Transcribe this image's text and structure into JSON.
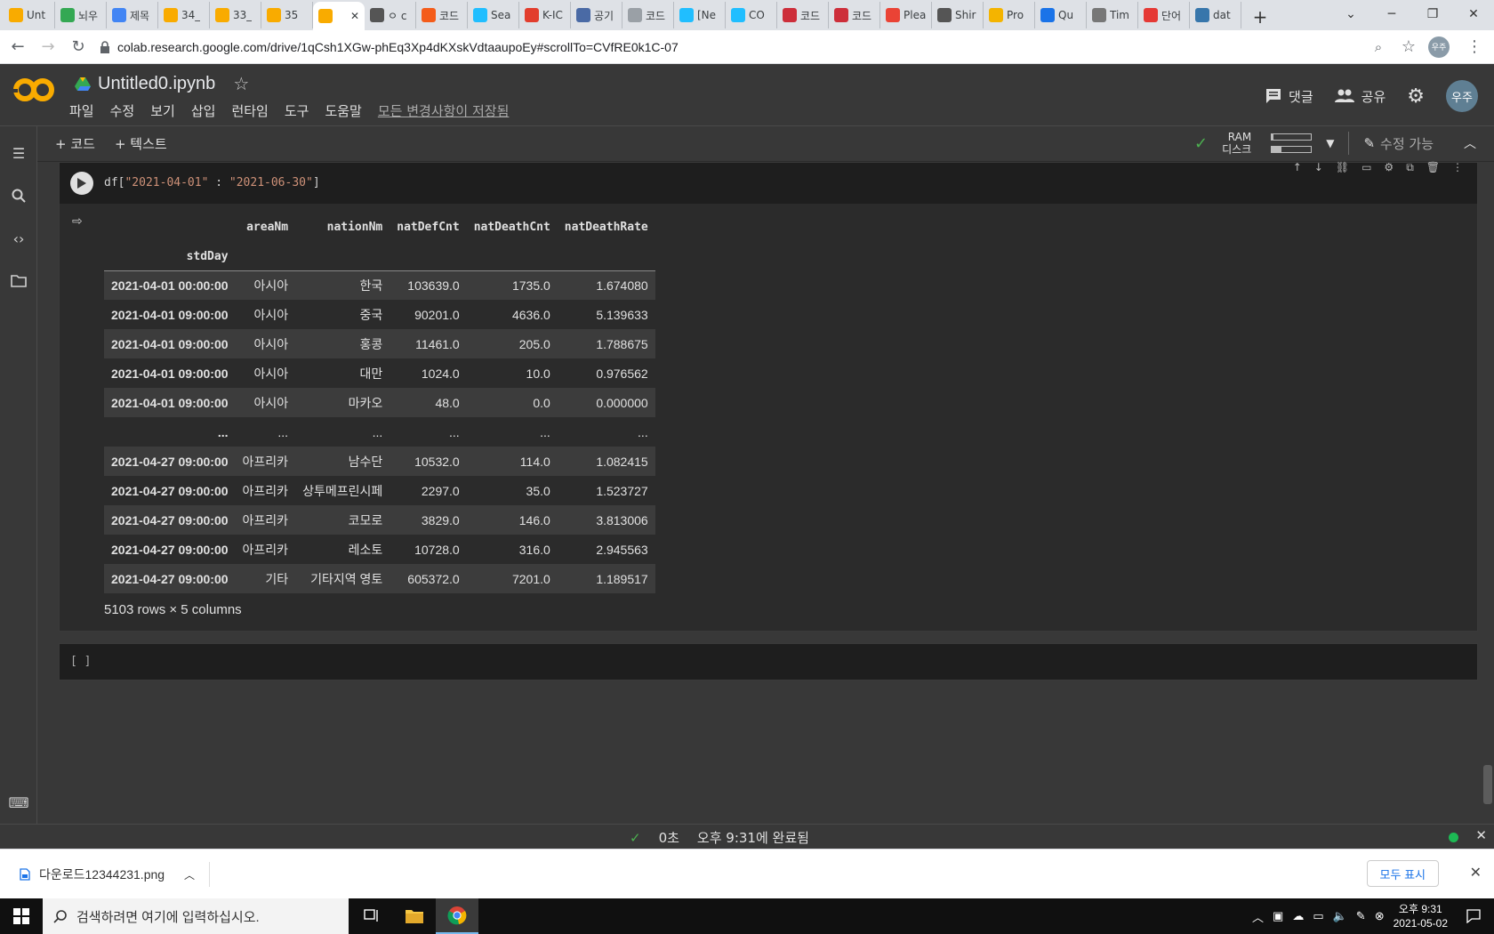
{
  "browser": {
    "tabs": [
      {
        "title": "Unt",
        "icon": "colab-icon",
        "color": "#f9ab00"
      },
      {
        "title": "뇌우",
        "icon": "drive-icon",
        "color": "#34a853"
      },
      {
        "title": "제목",
        "icon": "docs-icon",
        "color": "#4285f4"
      },
      {
        "title": "34_",
        "icon": "colab-icon",
        "color": "#f9ab00"
      },
      {
        "title": "33_",
        "icon": "colab-icon",
        "color": "#f9ab00"
      },
      {
        "title": "35",
        "icon": "colab-icon",
        "color": "#f9ab00"
      },
      {
        "title": "",
        "icon": "colab-icon",
        "color": "#f9ab00",
        "active": true
      },
      {
        "title": "ㅇ c",
        "icon": "dots-icon",
        "color": "#555"
      },
      {
        "title": "코드",
        "icon": "k-icon",
        "color": "#f45c1a"
      },
      {
        "title": "Sea",
        "icon": "k-icon",
        "color": "#20beff"
      },
      {
        "title": "K-IC",
        "icon": "k-icon",
        "color": "#e23d2d"
      },
      {
        "title": "공기",
        "icon": "globe-icon",
        "color": "#4a6aa5"
      },
      {
        "title": "코드",
        "icon": "globe-icon",
        "color": "#9aa0a6"
      },
      {
        "title": "[Ne",
        "icon": "k-icon",
        "color": "#20beff"
      },
      {
        "title": "CO",
        "icon": "k-icon",
        "color": "#20beff"
      },
      {
        "title": "코드",
        "icon": "flag-icon",
        "color": "#cd2e3a"
      },
      {
        "title": "코드",
        "icon": "flag-icon",
        "color": "#cd2e3a"
      },
      {
        "title": "Plea",
        "icon": "gmail-icon",
        "color": "#ea4335"
      },
      {
        "title": "Shir",
        "icon": "dots-icon",
        "color": "#555"
      },
      {
        "title": "Pro",
        "icon": "box-icon",
        "color": "#f4b400"
      },
      {
        "title": "Qu",
        "icon": "q-icon",
        "color": "#1a73e8"
      },
      {
        "title": "Tim",
        "icon": "image-icon",
        "color": "#777"
      },
      {
        "title": "단어",
        "icon": "z-icon",
        "color": "#e53935"
      },
      {
        "title": "dat",
        "icon": "python-icon",
        "color": "#3776ab"
      }
    ],
    "new_tab": "+",
    "url": "colab.research.google.com/drive/1qCsh1XGw-phEq3Xp4dKXskVdtaaupoEy#scrollTo=CVfRE0k1C-07",
    "profile": "우주"
  },
  "colab": {
    "notebook_title": "Untitled0.ipynb",
    "menu": [
      "파일",
      "수정",
      "보기",
      "삽입",
      "런타임",
      "도구",
      "도움말"
    ],
    "saved_status": "모든 변경사항이 저장됨",
    "comment_label": "댓글",
    "share_label": "공유",
    "avatar": "우주",
    "add_code": "+ 코드",
    "add_text": "+ 텍스트",
    "ram_label": "RAM",
    "disk_label": "디스크",
    "ram_usage": 0.05,
    "disk_usage": 0.25,
    "edit_mode": "수정 가능"
  },
  "cell": {
    "code_prefix": "df[",
    "code_str1": "\"2021-04-01\"",
    "code_sep": " : ",
    "code_str2": "\"2021-06-30\"",
    "code_suffix": "]",
    "empty_cell": "[ ]"
  },
  "dataframe": {
    "columns": [
      "areaNm",
      "nationNm",
      "natDefCnt",
      "natDeathCnt",
      "natDeathRate"
    ],
    "index_name": "stdDay",
    "rows": [
      [
        "2021-04-01 00:00:00",
        "아시아",
        "한국",
        "103639.0",
        "1735.0",
        "1.674080"
      ],
      [
        "2021-04-01 09:00:00",
        "아시아",
        "중국",
        "90201.0",
        "4636.0",
        "5.139633"
      ],
      [
        "2021-04-01 09:00:00",
        "아시아",
        "홍콩",
        "11461.0",
        "205.0",
        "1.788675"
      ],
      [
        "2021-04-01 09:00:00",
        "아시아",
        "대만",
        "1024.0",
        "10.0",
        "0.976562"
      ],
      [
        "2021-04-01 09:00:00",
        "아시아",
        "마카오",
        "48.0",
        "0.0",
        "0.000000"
      ],
      [
        "...",
        "...",
        "...",
        "...",
        "...",
        "..."
      ],
      [
        "2021-04-27 09:00:00",
        "아프리카",
        "남수단",
        "10532.0",
        "114.0",
        "1.082415"
      ],
      [
        "2021-04-27 09:00:00",
        "아프리카",
        "상투메프린시페",
        "2297.0",
        "35.0",
        "1.523727"
      ],
      [
        "2021-04-27 09:00:00",
        "아프리카",
        "코모로",
        "3829.0",
        "146.0",
        "3.813006"
      ],
      [
        "2021-04-27 09:00:00",
        "아프리카",
        "레소토",
        "10728.0",
        "316.0",
        "2.945563"
      ],
      [
        "2021-04-27 09:00:00",
        "기타",
        "기타지역 영토",
        "605372.0",
        "7201.0",
        "1.189517"
      ]
    ],
    "shape": "5103 rows × 5 columns"
  },
  "status": {
    "duration": "0초",
    "completed": "오후 9:31에 완료됨"
  },
  "downloads": {
    "file": "다운로드12344231.png",
    "show_all": "모두 표시"
  },
  "taskbar": {
    "search_placeholder": "검색하려면 여기에 입력하십시오.",
    "time": "오후 9:31",
    "date": "2021-05-02"
  }
}
